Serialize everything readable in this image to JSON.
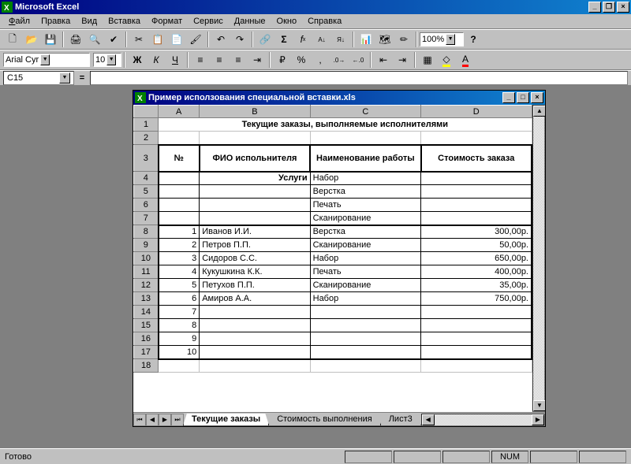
{
  "app": {
    "title": "Microsoft Excel"
  },
  "menu": {
    "file": "Файл",
    "edit": "Правка",
    "view": "Вид",
    "insert": "Вставка",
    "format": "Формат",
    "tools": "Сервис",
    "data": "Данные",
    "window": "Окно",
    "help": "Справка"
  },
  "toolbar": {
    "zoom": "100%"
  },
  "format_bar": {
    "font": "Arial Cyr",
    "size": "10"
  },
  "name_box": "C15",
  "workbook": {
    "title": "Пример исползования специальной вставки.xls",
    "sheets": [
      "Текущие заказы",
      "Стоимость выполнения",
      "Лист3"
    ],
    "active_sheet": 0,
    "cols": [
      "A",
      "B",
      "C",
      "D"
    ],
    "heading": "Текущие заказы, выполняемые исполнителями",
    "headers": {
      "num": "№",
      "fio": "ФИО испольнителя",
      "work": "Наименование работы",
      "cost": "Стоимость заказа"
    },
    "services_label": "Услуги",
    "services": [
      "Набор",
      "Верстка",
      "Печать",
      "Сканирование"
    ],
    "rows": [
      {
        "n": "1",
        "fio": "Иванов И.И.",
        "work": "Верстка",
        "cost": "300,00р."
      },
      {
        "n": "2",
        "fio": "Петров П.П.",
        "work": "Сканирование",
        "cost": "50,00р."
      },
      {
        "n": "3",
        "fio": "Сидоров С.С.",
        "work": "Набор",
        "cost": "650,00р."
      },
      {
        "n": "4",
        "fio": "Кукушкина К.К.",
        "work": "Печать",
        "cost": "400,00р."
      },
      {
        "n": "5",
        "fio": "Петухов П.П.",
        "work": "Сканирование",
        "cost": "35,00р."
      },
      {
        "n": "6",
        "fio": "Амиров А.А.",
        "work": "Набор",
        "cost": "750,00р."
      },
      {
        "n": "7",
        "fio": "",
        "work": "",
        "cost": ""
      },
      {
        "n": "8",
        "fio": "",
        "work": "",
        "cost": ""
      },
      {
        "n": "9",
        "fio": "",
        "work": "",
        "cost": ""
      },
      {
        "n": "10",
        "fio": "",
        "work": "",
        "cost": ""
      }
    ]
  },
  "status": {
    "ready": "Готово",
    "num": "NUM"
  }
}
